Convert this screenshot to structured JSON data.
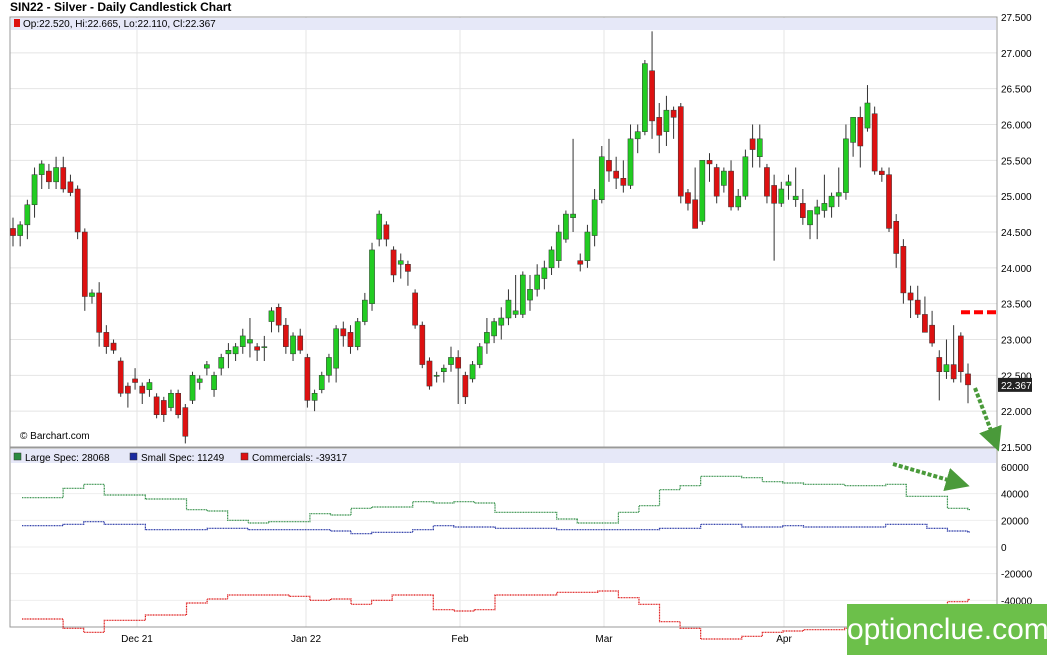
{
  "title": "SIN22 - Silver - Daily Candlestick Chart",
  "watermark": "optionclue.com",
  "chart_data": [
    {
      "type": "candlestick",
      "ohlc_label": "Op:22.520, Hi:22.665, Lo:22.110, Cl:22.367",
      "last_value_label": "22.367",
      "credit": "© Barchart.com",
      "y_ticks": [
        "27.500",
        "27.000",
        "26.500",
        "26.000",
        "25.500",
        "25.000",
        "24.500",
        "24.000",
        "23.500",
        "23.000",
        "22.500",
        "22.000",
        "21.500"
      ],
      "ylim": [
        21.5,
        27.5
      ],
      "x_tick_labels": [
        "Dec 21",
        "Jan 22",
        "Feb",
        "Mar",
        "Apr"
      ],
      "colors": {
        "up": "#22cc22",
        "down": "#dd1111",
        "wick": "#333333",
        "target": "#ff0000",
        "arrow": "#4a9a3a"
      },
      "candles": [
        [
          24.55,
          24.7,
          24.3,
          24.45
        ],
        [
          24.45,
          24.65,
          24.3,
          24.6
        ],
        [
          24.6,
          24.95,
          24.4,
          24.88
        ],
        [
          24.88,
          25.4,
          24.7,
          25.3
        ],
        [
          25.3,
          25.5,
          25.1,
          25.45
        ],
        [
          25.35,
          25.45,
          25.1,
          25.2
        ],
        [
          25.2,
          25.55,
          25.1,
          25.4
        ],
        [
          25.4,
          25.55,
          25.05,
          25.1
        ],
        [
          25.2,
          25.3,
          25.0,
          25.05
        ],
        [
          25.1,
          25.15,
          24.4,
          24.5
        ],
        [
          24.5,
          24.55,
          23.4,
          23.6
        ],
        [
          23.6,
          23.7,
          23.5,
          23.65
        ],
        [
          23.65,
          23.8,
          22.9,
          23.1
        ],
        [
          23.1,
          23.2,
          22.8,
          22.9
        ],
        [
          22.95,
          23.0,
          22.8,
          22.85
        ],
        [
          22.7,
          22.75,
          22.2,
          22.25
        ],
        [
          22.35,
          22.4,
          22.05,
          22.25
        ],
        [
          22.45,
          22.6,
          22.3,
          22.4
        ],
        [
          22.35,
          22.4,
          22.1,
          22.25
        ],
        [
          22.3,
          22.45,
          22.2,
          22.4
        ],
        [
          22.2,
          22.25,
          21.9,
          21.95
        ],
        [
          22.15,
          22.2,
          21.85,
          21.95
        ],
        [
          22.05,
          22.3,
          22.0,
          22.25
        ],
        [
          22.25,
          22.3,
          21.9,
          21.95
        ],
        [
          22.05,
          22.1,
          21.55,
          21.65
        ],
        [
          22.15,
          22.55,
          22.1,
          22.5
        ],
        [
          22.4,
          22.5,
          22.3,
          22.45
        ],
        [
          22.6,
          22.7,
          22.5,
          22.65
        ],
        [
          22.3,
          22.55,
          22.2,
          22.5
        ],
        [
          22.6,
          22.8,
          22.5,
          22.75
        ],
        [
          22.8,
          22.95,
          22.6,
          22.85
        ],
        [
          22.8,
          22.95,
          22.7,
          22.9
        ],
        [
          22.9,
          23.15,
          22.8,
          23.05
        ],
        [
          22.95,
          23.3,
          22.75,
          23.0
        ],
        [
          22.9,
          22.95,
          22.7,
          22.85
        ],
        [
          22.9,
          23.05,
          22.7,
          22.9
        ],
        [
          23.25,
          23.45,
          23.1,
          23.4
        ],
        [
          23.45,
          23.5,
          23.1,
          23.2
        ],
        [
          23.2,
          23.3,
          22.8,
          22.9
        ],
        [
          22.8,
          23.1,
          22.7,
          23.05
        ],
        [
          23.05,
          23.15,
          22.8,
          22.85
        ],
        [
          22.75,
          22.8,
          22.05,
          22.15
        ],
        [
          22.15,
          22.3,
          22.0,
          22.25
        ],
        [
          22.3,
          22.55,
          22.25,
          22.5
        ],
        [
          22.5,
          22.8,
          22.4,
          22.75
        ],
        [
          22.6,
          23.2,
          22.4,
          23.15
        ],
        [
          23.15,
          23.25,
          22.9,
          23.05
        ],
        [
          23.1,
          23.2,
          22.8,
          22.9
        ],
        [
          22.9,
          23.3,
          22.85,
          23.25
        ],
        [
          23.25,
          23.65,
          23.2,
          23.55
        ],
        [
          23.5,
          24.35,
          23.4,
          24.25
        ],
        [
          24.4,
          24.8,
          24.3,
          24.75
        ],
        [
          24.6,
          24.65,
          24.3,
          24.4
        ],
        [
          24.25,
          24.3,
          23.8,
          23.9
        ],
        [
          24.05,
          24.2,
          23.85,
          24.1
        ],
        [
          24.05,
          24.1,
          23.75,
          23.95
        ],
        [
          23.65,
          23.7,
          23.15,
          23.2
        ],
        [
          23.2,
          23.25,
          22.6,
          22.65
        ],
        [
          22.7,
          22.75,
          22.3,
          22.35
        ],
        [
          22.5,
          22.55,
          22.4,
          22.5
        ],
        [
          22.55,
          22.65,
          22.4,
          22.6
        ],
        [
          22.65,
          22.9,
          22.55,
          22.75
        ],
        [
          22.75,
          22.85,
          22.1,
          22.6
        ],
        [
          22.5,
          22.55,
          22.1,
          22.2
        ],
        [
          22.45,
          22.7,
          22.4,
          22.65
        ],
        [
          22.65,
          22.95,
          22.6,
          22.9
        ],
        [
          22.95,
          23.3,
          22.8,
          23.1
        ],
        [
          23.05,
          23.3,
          22.95,
          23.25
        ],
        [
          23.2,
          23.45,
          23.0,
          23.3
        ],
        [
          23.3,
          23.7,
          23.2,
          23.55
        ],
        [
          23.35,
          23.9,
          23.3,
          23.4
        ],
        [
          23.35,
          23.95,
          23.3,
          23.9
        ],
        [
          23.55,
          23.9,
          23.4,
          23.7
        ],
        [
          23.7,
          24.05,
          23.6,
          23.9
        ],
        [
          23.85,
          24.1,
          23.7,
          24.0
        ],
        [
          24.0,
          24.3,
          23.9,
          24.25
        ],
        [
          24.1,
          24.6,
          24.0,
          24.5
        ],
        [
          24.4,
          24.8,
          24.35,
          24.75
        ],
        [
          24.7,
          25.8,
          24.5,
          24.75
        ],
        [
          24.1,
          24.2,
          23.95,
          24.05
        ],
        [
          24.1,
          24.6,
          24.0,
          24.5
        ],
        [
          24.45,
          25.1,
          24.3,
          24.95
        ],
        [
          24.95,
          25.7,
          24.9,
          25.55
        ],
        [
          25.5,
          25.8,
          25.2,
          25.35
        ],
        [
          25.35,
          25.55,
          25.1,
          25.25
        ],
        [
          25.25,
          25.5,
          25.05,
          25.15
        ],
        [
          25.15,
          26.0,
          25.1,
          25.8
        ],
        [
          25.8,
          26.0,
          25.6,
          25.9
        ],
        [
          25.9,
          26.9,
          25.85,
          26.85
        ],
        [
          26.75,
          27.3,
          25.8,
          26.05
        ],
        [
          26.1,
          26.3,
          25.6,
          25.85
        ],
        [
          25.9,
          26.4,
          25.7,
          26.2
        ],
        [
          26.2,
          26.25,
          25.8,
          26.1
        ],
        [
          26.25,
          26.3,
          24.9,
          25.0
        ],
        [
          25.05,
          25.1,
          24.8,
          24.9
        ],
        [
          24.95,
          25.4,
          24.55,
          24.55
        ],
        [
          24.65,
          25.5,
          24.6,
          25.5
        ],
        [
          25.5,
          25.6,
          25.2,
          25.45
        ],
        [
          25.4,
          25.45,
          24.9,
          25.0
        ],
        [
          25.15,
          25.4,
          25.05,
          25.35
        ],
        [
          25.35,
          25.5,
          24.8,
          24.85
        ],
        [
          24.85,
          25.1,
          24.8,
          25.0
        ],
        [
          25.0,
          25.65,
          24.95,
          25.55
        ],
        [
          25.8,
          26.0,
          25.4,
          25.65
        ],
        [
          25.55,
          26.0,
          25.4,
          25.8
        ],
        [
          25.4,
          25.45,
          24.9,
          25.0
        ],
        [
          25.15,
          25.3,
          24.1,
          24.9
        ],
        [
          24.9,
          25.2,
          24.85,
          25.1
        ],
        [
          25.15,
          25.3,
          24.95,
          25.2
        ],
        [
          24.95,
          25.4,
          24.85,
          25.0
        ],
        [
          24.9,
          25.1,
          24.6,
          24.7
        ],
        [
          24.6,
          24.75,
          24.4,
          24.8
        ],
        [
          24.75,
          24.95,
          24.4,
          24.85
        ],
        [
          24.8,
          25.3,
          24.7,
          24.9
        ],
        [
          24.85,
          25.05,
          24.7,
          25.0
        ],
        [
          25.0,
          25.4,
          24.85,
          25.05
        ],
        [
          25.05,
          26.0,
          24.95,
          25.8
        ],
        [
          25.75,
          26.1,
          25.55,
          26.1
        ],
        [
          26.1,
          26.25,
          25.4,
          25.7
        ],
        [
          25.95,
          26.55,
          25.9,
          26.3
        ],
        [
          26.15,
          26.25,
          25.3,
          25.35
        ],
        [
          25.35,
          25.4,
          25.2,
          25.3
        ],
        [
          25.3,
          25.4,
          24.5,
          24.55
        ],
        [
          24.65,
          24.75,
          24.0,
          24.2
        ],
        [
          24.3,
          24.4,
          23.5,
          23.65
        ],
        [
          23.65,
          23.75,
          23.3,
          23.55
        ],
        [
          23.55,
          23.75,
          23.3,
          23.35
        ],
        [
          23.35,
          23.6,
          23.15,
          23.1
        ],
        [
          23.2,
          23.4,
          22.9,
          22.95
        ],
        [
          22.75,
          22.85,
          22.15,
          22.55
        ],
        [
          22.55,
          23.0,
          22.45,
          22.65
        ],
        [
          22.65,
          23.2,
          22.4,
          22.45
        ],
        [
          23.05,
          23.1,
          22.4,
          22.55
        ],
        [
          22.52,
          22.665,
          22.11,
          22.367
        ]
      ],
      "target_level": 23.38
    },
    {
      "type": "line",
      "legend": [
        {
          "name": "Large Spec: 28068",
          "color": "#2a8a40"
        },
        {
          "name": "Small Spec: 11249",
          "color": "#1a2aa0"
        },
        {
          "name": "Commercials: -39317",
          "color": "#dd1111"
        }
      ],
      "y_ticks": [
        "60000",
        "40000",
        "20000",
        "0",
        "-20000",
        "-40000",
        "-60000"
      ],
      "ylim": [
        -60000,
        60000
      ],
      "series": [
        {
          "name": "Large Spec: 28068",
          "values": [
            37000,
            37000,
            44000,
            47000,
            39000,
            39000,
            36000,
            36000,
            28000,
            27000,
            20000,
            18000,
            19000,
            19000,
            25000,
            24000,
            29000,
            30000,
            30000,
            34000,
            33000,
            34000,
            33000,
            26000,
            26000,
            26000,
            21000,
            18000,
            18000,
            26000,
            31000,
            43000,
            46000,
            53000,
            53000,
            52000,
            49000,
            48000,
            47000,
            47000,
            46000,
            46000,
            47000,
            38000,
            38000,
            29000,
            28068
          ]
        },
        {
          "name": "Small Spec: 11249",
          "values": [
            16000,
            16000,
            17000,
            19000,
            17000,
            17000,
            13000,
            13000,
            13000,
            14000,
            14000,
            13000,
            13000,
            13000,
            13000,
            12000,
            10000,
            11000,
            11000,
            13000,
            16000,
            15000,
            15000,
            14000,
            14000,
            14000,
            13000,
            13000,
            13000,
            13000,
            13000,
            14000,
            14000,
            17000,
            17000,
            15000,
            15000,
            16000,
            15000,
            15000,
            15000,
            15000,
            17000,
            17000,
            14000,
            12000,
            11249
          ]
        },
        {
          "name": "Commercials: -39317",
          "values": [
            -54000,
            -54000,
            -61000,
            -64000,
            -55000,
            -55000,
            -51000,
            -51000,
            -42000,
            -39000,
            -36000,
            -36000,
            -36000,
            -37000,
            -40000,
            -39000,
            -43000,
            -40000,
            -36000,
            -36000,
            -47000,
            -48000,
            -47000,
            -36000,
            -36000,
            -36000,
            -34000,
            -34000,
            -33000,
            -38000,
            -43000,
            -56000,
            -61000,
            -69000,
            -69000,
            -67000,
            -64000,
            -63000,
            -62000,
            -62000,
            -61000,
            -61000,
            -62000,
            -57000,
            -51000,
            -41000,
            -39317
          ]
        }
      ]
    }
  ]
}
